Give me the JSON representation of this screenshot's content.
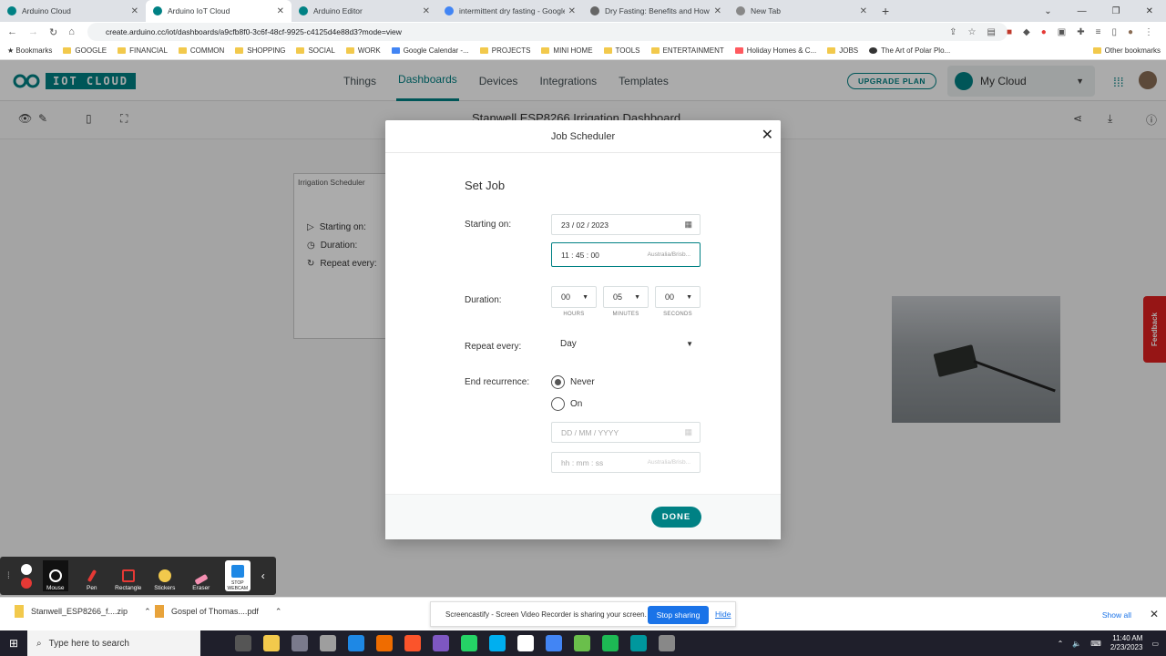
{
  "browser": {
    "tabs": [
      {
        "title": "Arduino Cloud",
        "color": "#008184"
      },
      {
        "title": "Arduino IoT Cloud",
        "color": "#008184"
      },
      {
        "title": "Arduino Editor",
        "color": "#008184"
      },
      {
        "title": "intermittent dry fasting - Google",
        "color": "#4285f4"
      },
      {
        "title": "Dry Fasting: Benefits and How To",
        "color": "#666666"
      },
      {
        "title": "New Tab",
        "color": "#888888"
      }
    ],
    "url": "create.arduino.cc/iot/dashboards/a9cfb8f0-3c6f-48cf-9925-c4125d4e88d3?mode=view",
    "bookmarks": [
      "Bookmarks",
      "GOOGLE",
      "FINANCIAL",
      "COMMON",
      "SHOPPING",
      "SOCIAL",
      "WORK",
      "Google Calendar -...",
      "PROJECTS",
      "MINI HOME",
      "TOOLS",
      "ENTERTAINMENT",
      "Holiday Homes & C...",
      "JOBS",
      "The Art of Polar Plo..."
    ],
    "other_bookmarks": "Other bookmarks"
  },
  "app": {
    "brand": "IOT CLOUD",
    "nav": [
      "Things",
      "Dashboards",
      "Devices",
      "Integrations",
      "Templates"
    ],
    "upgrade": "UPGRADE PLAN",
    "cloud": "My Cloud",
    "dashboard_title": "Stanwell ESP8266 Irrigation Dashboard"
  },
  "widget": {
    "title": "Irrigation Scheduler",
    "rows": [
      "Starting on:",
      "Duration:",
      "Repeat every:"
    ]
  },
  "feedback": "Feedback",
  "modal": {
    "title": "Job Scheduler",
    "heading": "Set Job",
    "starting_label": "Starting on:",
    "date": "23 / 02 / 2023",
    "time": "11 : 45 : 00",
    "timezone": "Australia/Brisb...",
    "duration_label": "Duration:",
    "hours": "00",
    "minutes": "05",
    "seconds": "00",
    "hours_unit": "HOURS",
    "minutes_unit": "MINUTES",
    "seconds_unit": "SECONDS",
    "repeat_label": "Repeat every:",
    "repeat_value": "Day",
    "end_label": "End recurrence:",
    "never": "Never",
    "on": "On",
    "date_placeholder": "DD / MM / YYYY",
    "time_placeholder": "hh : mm : ss",
    "timezone2": "Australia/Brisb...",
    "done": "DONE"
  },
  "screencastify": {
    "tools": [
      "Mouse",
      "Pen",
      "Rectangle",
      "Stickers",
      "Eraser",
      "STOP WEBCAM"
    ]
  },
  "downloads": {
    "items": [
      "Stanwell_ESP8266_f....zip",
      "Gospel of Thomas....pdf"
    ],
    "share_text": "Screencastify - Screen Video Recorder is sharing your screen.",
    "stop_sharing": "Stop sharing",
    "hide": "Hide",
    "show_all": "Show all"
  },
  "taskbar": {
    "search": "Type here to search",
    "time": "11:40 AM",
    "date": "2/23/2023"
  }
}
